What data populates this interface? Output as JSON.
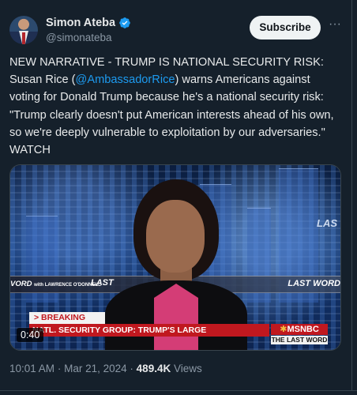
{
  "author": {
    "name": "Simon Ateba",
    "handle": "@simonateba",
    "verified": true
  },
  "actions": {
    "subscribe_label": "Subscribe",
    "more_label": "···"
  },
  "tweet": {
    "text_before": "NEW NARRATIVE - TRUMP IS NATIONAL SECURITY RISK: Susan Rice (",
    "mention": "@AmbassadorRice",
    "text_after": ") warns Americans against voting for Donald Trump because he's a national security risk: \"Trump clearly doesn't put American interests ahead of his own, so we're deeply vulnerable to exploitation by our adversaries.\" WATCH"
  },
  "video": {
    "timer": "0:40",
    "lower_third_left": "VORD",
    "lower_third_left_small": "with LAWRENCE O'DONNELL",
    "lower_third_mid": "LAST",
    "lower_third_right": "LAST WORD",
    "wall_text": "LAS",
    "breaking_label": "> BREAKING NEWS",
    "chyron_text": "NATL. SECURITY GROUP:  TRUMP'S LARGE",
    "network_logo": "MSNBC",
    "show_tag": "THE LAST WORD"
  },
  "meta": {
    "time": "10:01 AM",
    "date": "Mar 21, 2024",
    "separator": "·",
    "views_count": "489.4K",
    "views_label": "Views"
  },
  "colors": {
    "background": "#15202b",
    "accent": "#1d9bf0",
    "muted": "#8b98a5",
    "chyron_red": "#c0181f"
  }
}
